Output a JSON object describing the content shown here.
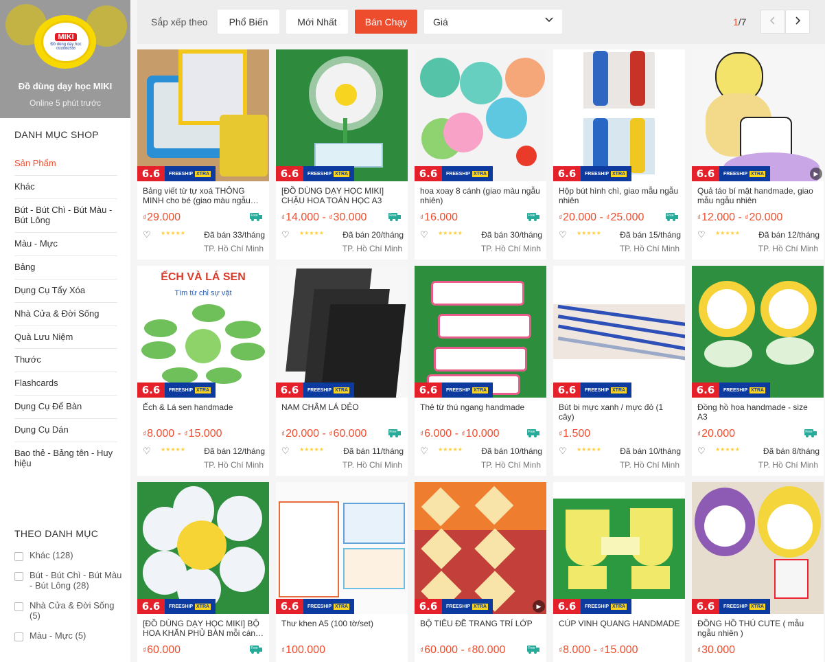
{
  "shop": {
    "name": "Đồ dùng dạy học MIKI",
    "status": "Online 5 phút trước",
    "logo_brand": "MIKI",
    "logo_sub": "Đồ dùng dạy học",
    "logo_phone": "0918882588"
  },
  "sidebar": {
    "category_title": "DANH MỤC SHOP",
    "categories": [
      {
        "label": "Sản Phẩm"
      },
      {
        "label": "Khác"
      },
      {
        "label": "Bút - Bút Chì - Bút Màu - Bút Lông"
      },
      {
        "label": "Màu - Mực"
      },
      {
        "label": "Bảng"
      },
      {
        "label": "Dụng Cụ Tẩy Xóa"
      },
      {
        "label": "Nhà Cửa & Đời Sống"
      },
      {
        "label": "Quà Lưu Niệm"
      },
      {
        "label": "Thước"
      },
      {
        "label": "Flashcards"
      },
      {
        "label": "Dụng Cụ Để Bàn"
      },
      {
        "label": "Dụng Cụ Dán"
      },
      {
        "label": "Bao thẻ - Bảng tên - Huy hiệu"
      }
    ],
    "filter_title": "THEO DANH MỤC",
    "filters": [
      {
        "label": "Khác (128)"
      },
      {
        "label": "Bút - Bút Chì - Bút Màu - Bút Lông (28)"
      },
      {
        "label": "Nhà Cửa & Đời Sống (5)"
      },
      {
        "label": "Màu - Mực (5)"
      }
    ]
  },
  "sortbar": {
    "label": "Sắp xếp theo",
    "popular": "Phổ Biến",
    "newest": "Mới Nhất",
    "bestselling": "Bán Chạy",
    "price": "Giá",
    "page_current": "1",
    "page_total": "/7"
  },
  "badges": {
    "sale": "6.6",
    "freeship": "FREESHIP",
    "xtra": "XTRA",
    "free_tag": "Free"
  },
  "colors": {
    "accent": "#ee4d2d",
    "freeship_blue": "#0d3a9e",
    "free_teal": "#26aa99"
  },
  "products": [
    {
      "name": "Bảng viết từ tự xoá THÔNG MINH cho bé (giao màu ngẫu…",
      "price_from": "29.000",
      "price_to": "",
      "sold": "Đã bán 33/tháng",
      "location": "TP. Hồ Chí Minh",
      "free": true,
      "video": false,
      "art": "board"
    },
    {
      "name": "[ĐỒ DÙNG DẠY HỌC MIKI] CHẬU HOA TOÁN HỌC A3",
      "price_from": "14.000",
      "price_to": "30.000",
      "sold": "Đã bán 20/tháng",
      "location": "TP. Hồ Chí Minh",
      "free": true,
      "video": false,
      "art": "flowerpot"
    },
    {
      "name": "hoa xoay 8 cánh (giao màu ngẫu nhiên)",
      "price_from": "16.000",
      "price_to": "",
      "sold": "Đã bán 30/tháng",
      "location": "TP. Hồ Chí Minh",
      "free": true,
      "video": false,
      "art": "flowers"
    },
    {
      "name": "Hộp bút hình chì, giao mẫu ngẫu nhiên",
      "price_from": "20.000",
      "price_to": "25.000",
      "sold": "Đã bán 15/tháng",
      "location": "TP. Hồ Chí Minh",
      "free": true,
      "video": false,
      "art": "pencils"
    },
    {
      "name": "Quả táo bí mật handmade, giao mẫu ngẫu nhiên",
      "price_from": "12.000",
      "price_to": "20.000",
      "sold": "Đã bán 12/tháng",
      "location": "TP. Hồ Chí Minh",
      "free": false,
      "video": true,
      "art": "apple"
    },
    {
      "name": "Ếch & Lá sen handmade",
      "price_from": "8.000",
      "price_to": "15.000",
      "sold": "Đã bán 12/tháng",
      "location": "TP. Hồ Chí Minh",
      "free": false,
      "video": false,
      "art": "frog",
      "art_title": "ẾCH VÀ LÁ SEN",
      "art_sub": "Tìm từ chỉ sự vật"
    },
    {
      "name": "NAM CHÂM LÁ DẺO",
      "price_from": "20.000",
      "price_to": "60.000",
      "sold": "Đã bán 11/tháng",
      "location": "TP. Hồ Chí Minh",
      "free": true,
      "video": false,
      "art": "magnet"
    },
    {
      "name": "Thẻ từ thú ngang handmade",
      "price_from": "6.000",
      "price_to": "10.000",
      "sold": "Đã bán 10/tháng",
      "location": "TP. Hồ Chí Minh",
      "free": true,
      "video": false,
      "art": "cards"
    },
    {
      "name": "Bút bi mực xanh / mực đỏ (1 cây)",
      "price_from": "1.500",
      "price_to": "",
      "sold": "Đã bán 10/tháng",
      "location": "TP. Hồ Chí Minh",
      "free": false,
      "video": false,
      "art": "pens"
    },
    {
      "name": "Đồng hồ hoa handmade - size A3",
      "price_from": "20.000",
      "price_to": "",
      "sold": "Đã bán 8/tháng",
      "location": "TP. Hồ Chí Minh",
      "free": true,
      "video": false,
      "art": "clockflower"
    },
    {
      "name": "[ĐỒ DÙNG DẠY HỌC MIKI] BỘ HOA KHĂN PHỦ BÀN mỗi cán…",
      "price_from": "60.000",
      "price_to": "",
      "sold": "",
      "location": "",
      "free": true,
      "video": false,
      "art": "bigflower"
    },
    {
      "name": "Thư khen A5 (100 tờ/set)",
      "price_from": "100.000",
      "price_to": "",
      "sold": "",
      "location": "",
      "free": false,
      "video": false,
      "art": "letters"
    },
    {
      "name": "BỘ TIÊU ĐỀ TRANG TRÍ LỚP",
      "price_from": "60.000",
      "price_to": "80.000",
      "sold": "",
      "location": "",
      "free": true,
      "video": true,
      "art": "banners"
    },
    {
      "name": "CÚP VINH QUANG HANDMADE",
      "price_from": "8.000",
      "price_to": "15.000",
      "sold": "",
      "location": "",
      "free": false,
      "video": false,
      "art": "cups"
    },
    {
      "name": "ĐỒNG HỒ THÚ CUTE ( mẫu ngẫu nhiên )",
      "price_from": "30.000",
      "price_to": "",
      "sold": "",
      "location": "",
      "free": false,
      "video": false,
      "art": "animalclock"
    }
  ]
}
